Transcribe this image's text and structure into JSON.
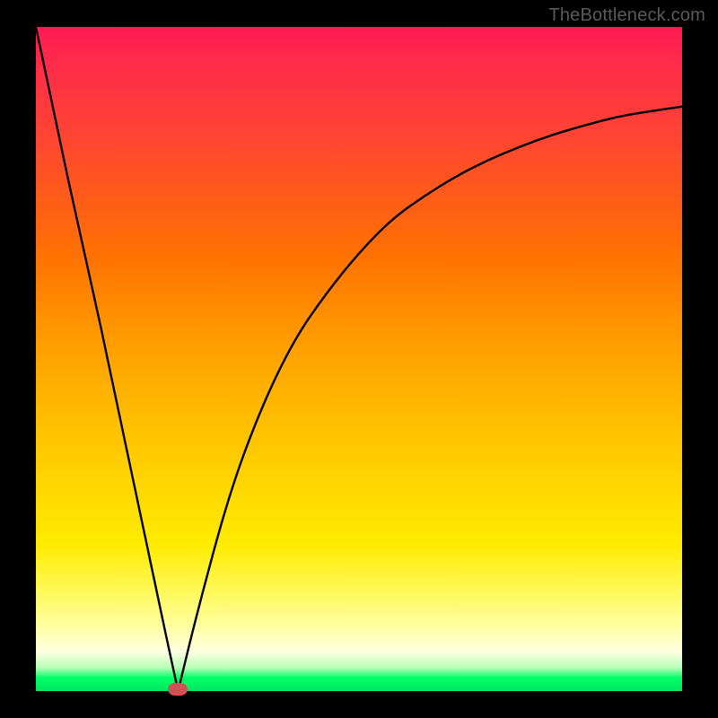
{
  "watermark": "TheBottleneck.com",
  "colors": {
    "frame": "#000000",
    "curve": "#000000",
    "marker": "#d35054",
    "gradient_top": "#ff1a53",
    "gradient_bottom": "#00e661"
  },
  "chart_data": {
    "type": "line",
    "title": "",
    "xlabel": "",
    "ylabel": "",
    "xlim": [
      0,
      100
    ],
    "ylim": [
      0,
      100
    ],
    "grid": false,
    "legend": false,
    "note": "V-shaped bottleneck curve; minimum near x≈22 at y≈0; left branch nearly linear from (0,100) to (22,0); right branch asymptotic toward y≈88 as x→100. Values estimated from pixels with no axis labels.",
    "series": [
      {
        "name": "curve",
        "x": [
          0,
          5,
          10,
          15,
          20,
          22,
          25,
          30,
          35,
          40,
          45,
          50,
          55,
          60,
          65,
          70,
          75,
          80,
          85,
          90,
          95,
          100
        ],
        "y": [
          100,
          77,
          55,
          32,
          9,
          0,
          12,
          30,
          43,
          53,
          60,
          66,
          71,
          74.5,
          77.5,
          80,
          82,
          83.8,
          85.2,
          86.5,
          87.3,
          88
        ]
      }
    ],
    "marker": {
      "x": 22,
      "y": 0
    }
  }
}
